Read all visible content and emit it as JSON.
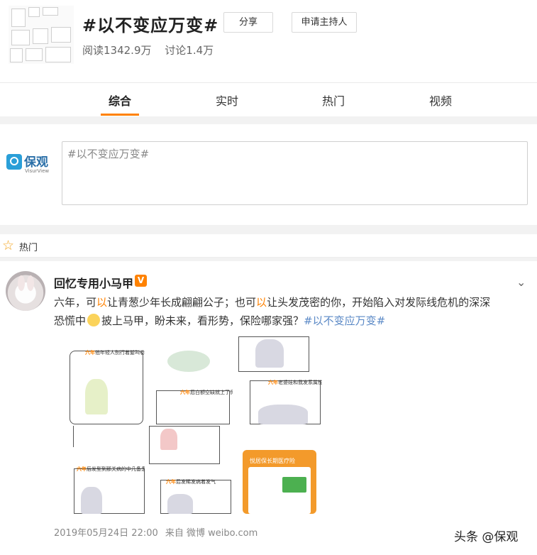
{
  "topic": {
    "title": "#以不变应万变#",
    "share_label": "分享",
    "host_label": "申请主持人",
    "read_label": "阅读1342.9万",
    "discuss_label": "讨论1.4万"
  },
  "tabs": [
    {
      "label": "综合",
      "active": true
    },
    {
      "label": "实时",
      "active": false
    },
    {
      "label": "热门",
      "active": false
    },
    {
      "label": "视频",
      "active": false
    }
  ],
  "compose": {
    "brand_name": "保观",
    "brand_sub": "VisurView",
    "text": "#以不变应万变#"
  },
  "hot_section": {
    "label": "热门",
    "icon": "star-outline-icon"
  },
  "post": {
    "username": "回忆专用小马甲",
    "verified_badge": "V",
    "text_line1_a": "六年，可",
    "text_line1_hl1": "以",
    "text_line1_b": "让青葱少年长成翩翩公子；也可",
    "text_line1_hl2": "以",
    "text_line1_c": "让头发茂密的你，开始陷入对发际线危机的深深",
    "text_line2_a": "恐慌中",
    "text_line2_b": "披上马甲，盼未来，看形势，保险哪家强？",
    "hashtag": "#以不变应万变#",
    "image_captions": [
      {
        "hl": "六年",
        "rest": "他年轻人别行着髮叫卷"
      },
      {
        "hl": "六年",
        "rest": "后白额空缺就上了保印"
      },
      {
        "hl": "六年",
        "rest": "老婆娃和我发系属性"
      },
      {
        "hl": "六年",
        "rest": "后发型到那关病的中几备患人"
      },
      {
        "hl": "六年",
        "rest": "后发稀发病着发气"
      },
      {
        "hl": "",
        "rest": "悦居保长期医疗险"
      }
    ],
    "timestamp": "2019年05月24日 22:00",
    "source": "来自 微博 weibo.com"
  },
  "watermark": "头条 @保观",
  "colors": {
    "accent": "#ff8200",
    "link": "#5b89c6",
    "divider": "#f2f2f2"
  }
}
